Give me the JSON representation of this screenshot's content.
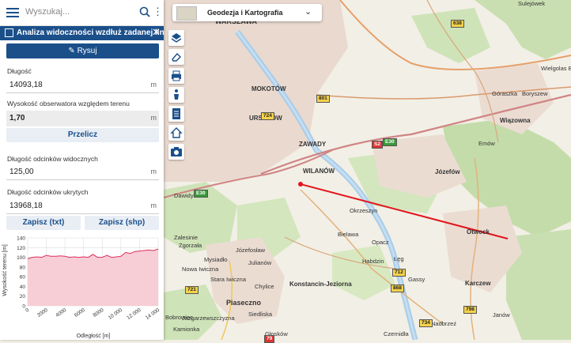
{
  "search": {
    "placeholder": "Wyszukaj..."
  },
  "panel": {
    "title": "Analiza widoczności wzdłuż zadanej linii",
    "draw_button": "Rysuj",
    "length_label": "Długość",
    "length_value": "14093,18",
    "length_unit": "m",
    "observer_label": "Wysokość obserwatora względem terenu",
    "observer_value": "1,70",
    "observer_unit": "m",
    "recalc_button": "Przelicz",
    "visible_label": "Długość odcinków widocznych",
    "visible_value": "125,00",
    "visible_unit": "m",
    "hidden_label": "Długość odcinków ukrytych",
    "hidden_value": "13968,18",
    "hidden_unit": "m",
    "save_txt": "Zapisz (txt)",
    "save_shp": "Zapisz (shp)"
  },
  "chart_data": {
    "type": "area",
    "xlabel": "Odległość [m]",
    "ylabel": "Wysokość terenu [m]",
    "xlim": [
      0,
      14000
    ],
    "ylim": [
      0,
      140
    ],
    "xticks": [
      0,
      2000,
      4000,
      6000,
      8000,
      10000,
      12000,
      14000
    ],
    "xtick_labels": [
      "0",
      "2000",
      "4000",
      "6000",
      "8000",
      "10 000",
      "12 000",
      "14 000"
    ],
    "yticks": [
      0,
      20,
      40,
      60,
      80,
      100,
      120,
      140
    ],
    "grid": true,
    "series": [
      {
        "x": [
          0,
          500,
          1000,
          1500,
          2000,
          2500,
          3000,
          3500,
          4000,
          4500,
          5000,
          5500,
          6000,
          6500,
          7000,
          7500,
          8000,
          8500,
          9000,
          9500,
          10000,
          10500,
          11000,
          11500,
          12000,
          12500,
          13000,
          13500,
          14000
        ],
        "y": [
          97,
          100,
          101,
          100,
          104,
          102,
          102,
          103,
          102,
          100,
          101,
          100,
          101,
          100,
          106,
          100,
          100,
          104,
          100,
          101,
          102,
          110,
          108,
          112,
          113,
          114,
          115,
          114,
          117
        ]
      }
    ],
    "colors": {
      "fill": "#f7cdd6",
      "line": "#e0305a"
    }
  },
  "basemap": {
    "combo_label": "Geodezja i Kartografia"
  },
  "places": {
    "warszawa": "WARSZAWA",
    "mokotow": "MOKOTÓW",
    "wilanow": "WILANÓW",
    "zawady": "ZAWADY",
    "jozefow": "Józefów",
    "wiazowna": "Wiązowna",
    "otwock": "Otwock",
    "karczew": "Karczew",
    "piaseczno": "Piaseczno",
    "konstancin": "Konstancin-Jeziorna",
    "okrzeszyn": "Okrzeszyn",
    "bielawa": "Bielawa",
    "opacz": "Opacz",
    "habdzin": "Habdzin",
    "leg": "Łęg",
    "gassy": "Gassy",
    "sulejowek": "Sulejówek",
    "wielgolas": "Wielgolas B",
    "emow": "Emów",
    "boryszew": "Boryszew",
    "goraszka": "Góraszka",
    "julianow": "Julianów",
    "chylice": "Chylice",
    "siedliska": "Siedliska",
    "bobrowiec": "Bobrowiec",
    "kamionka": "Kamionka",
    "zalesinie": "Zalesinie",
    "zgorzala": "Zgorzała",
    "dawidy": "Dawidy",
    "mysiadlo": "Mysiadło",
    "nowa_iwiczna": "Nowa Iwiczna",
    "stara_iwiczna": "Stara Iwiczna",
    "jozefoslaw": "Józefosław",
    "jazgarzewszczyzna": "Jazgarzewszczyzna",
    "glosków": "Głosków",
    "zoltowo": "Nadbrzeż",
    "ursus": "URSYNÓW",
    "janow": "Janów",
    "czernidla": "Czernidła"
  },
  "roads": [
    "638",
    "801",
    "724",
    "S2",
    "S2",
    "E30",
    "E30",
    "721",
    "712",
    "868",
    "734",
    "798",
    "79",
    "721"
  ]
}
